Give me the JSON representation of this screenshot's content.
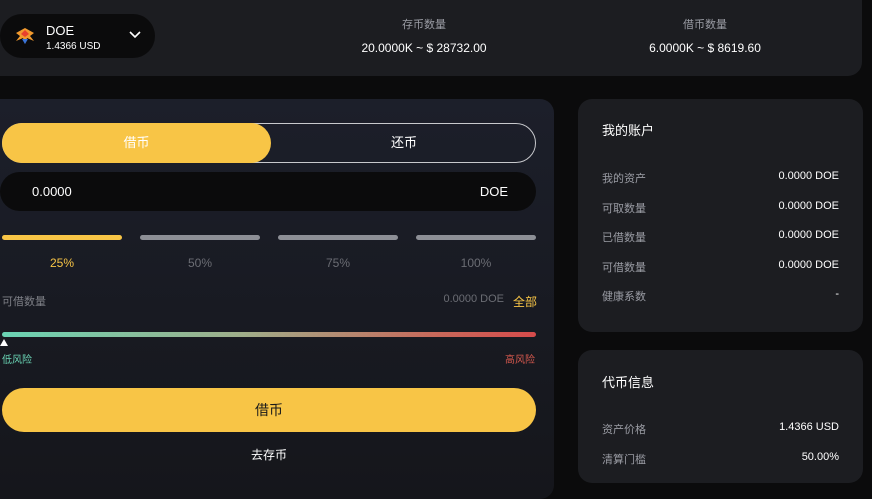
{
  "asset": {
    "name": "DOE",
    "price": "1.4366 USD",
    "logo_icon": "doe-bird-logo-icon",
    "dropdown_icon": "chevron-down-icon"
  },
  "stats": {
    "deposit_label": "存币数量",
    "deposit_value": "20.0000K ~ $ 28732.00",
    "borrow_label": "借币数量",
    "borrow_value": "6.0000K ~ $ 8619.60"
  },
  "tabs": {
    "borrow": "借币",
    "repay": "还币"
  },
  "amount": {
    "value": "0.0000",
    "unit": "DOE"
  },
  "percent_options": [
    {
      "label": "25%",
      "active": true
    },
    {
      "label": "50%",
      "active": false
    },
    {
      "label": "75%",
      "active": false
    },
    {
      "label": "100%",
      "active": false
    }
  ],
  "available": {
    "label": "可借数量",
    "value": "0.0000 DOE",
    "all": "全部"
  },
  "risk": {
    "low": "低风险",
    "high": "高风险",
    "level": 0
  },
  "actions": {
    "submit": "借币",
    "go_deposit": "去存币"
  },
  "account": {
    "title": "我的账户",
    "rows": [
      {
        "label": "我的资产",
        "value": "0.0000 DOE"
      },
      {
        "label": "可取数量",
        "value": "0.0000 DOE"
      },
      {
        "label": "已借数量",
        "value": "0.0000 DOE"
      },
      {
        "label": "可借数量",
        "value": "0.0000 DOE"
      },
      {
        "label": "健康系数",
        "value": "-"
      }
    ]
  },
  "token_info": {
    "title": "代币信息",
    "rows": [
      {
        "label": "资产价格",
        "value": "1.4366 USD"
      },
      {
        "label": "清算门槛",
        "value": "50.00%"
      }
    ]
  },
  "colors": {
    "accent": "#f8c546",
    "low_risk": "#6ad4b4",
    "high_risk": "#d6584d"
  }
}
